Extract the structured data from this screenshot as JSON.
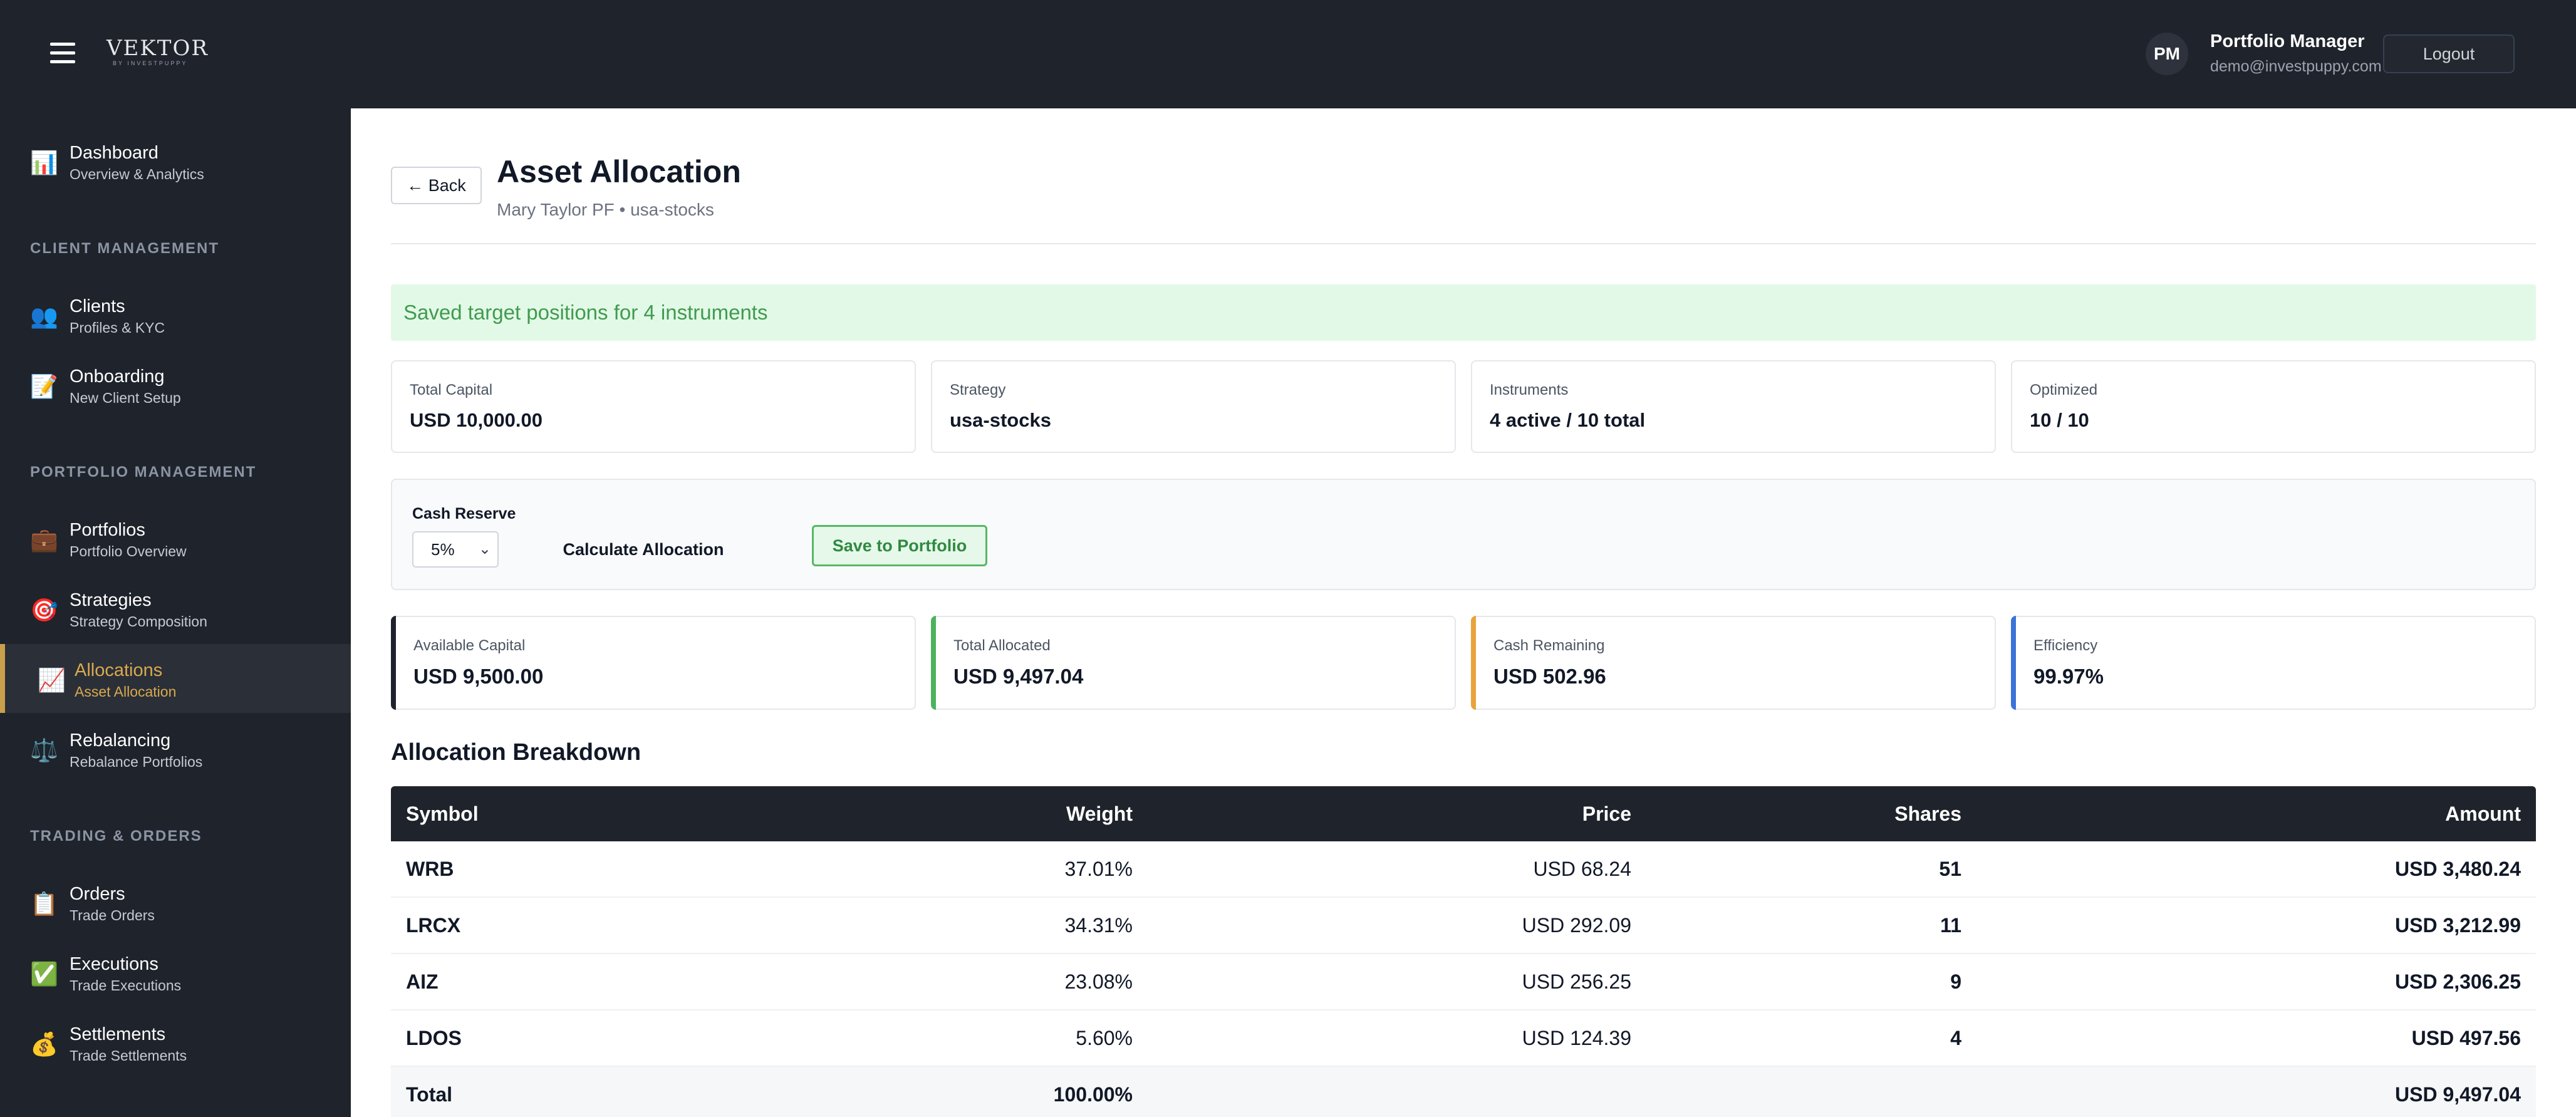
{
  "header": {
    "logo_text": "VEKTOR",
    "logo_sub": "BY INVESTPUPPY",
    "avatar": "PM",
    "user_name": "Portfolio Manager",
    "user_email": "demo@investpuppy.com",
    "logout_label": "Logout"
  },
  "sidebar": {
    "items": [
      {
        "icon": "📊",
        "title": "Dashboard",
        "sub": "Overview & Analytics"
      },
      {
        "icon": "👥",
        "title": "Clients",
        "sub": "Profiles & KYC"
      },
      {
        "icon": "📝",
        "title": "Onboarding",
        "sub": "New Client Setup"
      },
      {
        "icon": "💼",
        "title": "Portfolios",
        "sub": "Portfolio Overview"
      },
      {
        "icon": "🎯",
        "title": "Strategies",
        "sub": "Strategy Composition"
      },
      {
        "icon": "📈",
        "title": "Allocations",
        "sub": "Asset Allocation"
      },
      {
        "icon": "⚖️",
        "title": "Rebalancing",
        "sub": "Rebalance Portfolios"
      },
      {
        "icon": "📋",
        "title": "Orders",
        "sub": "Trade Orders"
      },
      {
        "icon": "✅",
        "title": "Executions",
        "sub": "Trade Executions"
      },
      {
        "icon": "💰",
        "title": "Settlements",
        "sub": "Trade Settlements"
      }
    ],
    "sections": {
      "client": "CLIENT MANAGEMENT",
      "portfolio": "PORTFOLIO MANAGEMENT",
      "trading": "TRADING & ORDERS"
    }
  },
  "page": {
    "back_label": "← Back",
    "title": "Asset Allocation",
    "subtitle": "Mary Taylor PF • usa-stocks",
    "banner": "Saved target positions for 4 instruments"
  },
  "stats": [
    {
      "label": "Total Capital",
      "value": "USD 10,000.00"
    },
    {
      "label": "Strategy",
      "value": "usa-stocks"
    },
    {
      "label": "Instruments",
      "value": "4 active / 10 total"
    },
    {
      "label": "Optimized",
      "value": "10 / 10"
    }
  ],
  "controls": {
    "cash_reserve_label": "Cash Reserve",
    "cash_reserve_value": "5%",
    "calculate_label": "Calculate Allocation",
    "save_label": "Save to Portfolio"
  },
  "metrics": [
    {
      "label": "Available Capital",
      "value": "USD 9,500.00",
      "color": "#1f232b"
    },
    {
      "label": "Total Allocated",
      "value": "USD 9,497.04",
      "color": "#4cb35c"
    },
    {
      "label": "Cash Remaining",
      "value": "USD 502.96",
      "color": "#e8a33b"
    },
    {
      "label": "Efficiency",
      "value": "99.97%",
      "color": "#3b74d9"
    }
  ],
  "breakdown": {
    "title": "Allocation Breakdown",
    "columns": [
      "Symbol",
      "Weight",
      "Price",
      "Shares",
      "Amount"
    ],
    "rows": [
      {
        "symbol": "WRB",
        "weight": "37.01%",
        "price": "USD 68.24",
        "shares": "51",
        "amount": "USD 3,480.24"
      },
      {
        "symbol": "LRCX",
        "weight": "34.31%",
        "price": "USD 292.09",
        "shares": "11",
        "amount": "USD 3,212.99"
      },
      {
        "symbol": "AIZ",
        "weight": "23.08%",
        "price": "USD 256.25",
        "shares": "9",
        "amount": "USD 2,306.25"
      },
      {
        "symbol": "LDOS",
        "weight": "5.60%",
        "price": "USD 124.39",
        "shares": "4",
        "amount": "USD 497.56"
      }
    ],
    "total": {
      "label": "Total",
      "weight": "100.00%",
      "amount": "USD 9,497.04"
    }
  }
}
